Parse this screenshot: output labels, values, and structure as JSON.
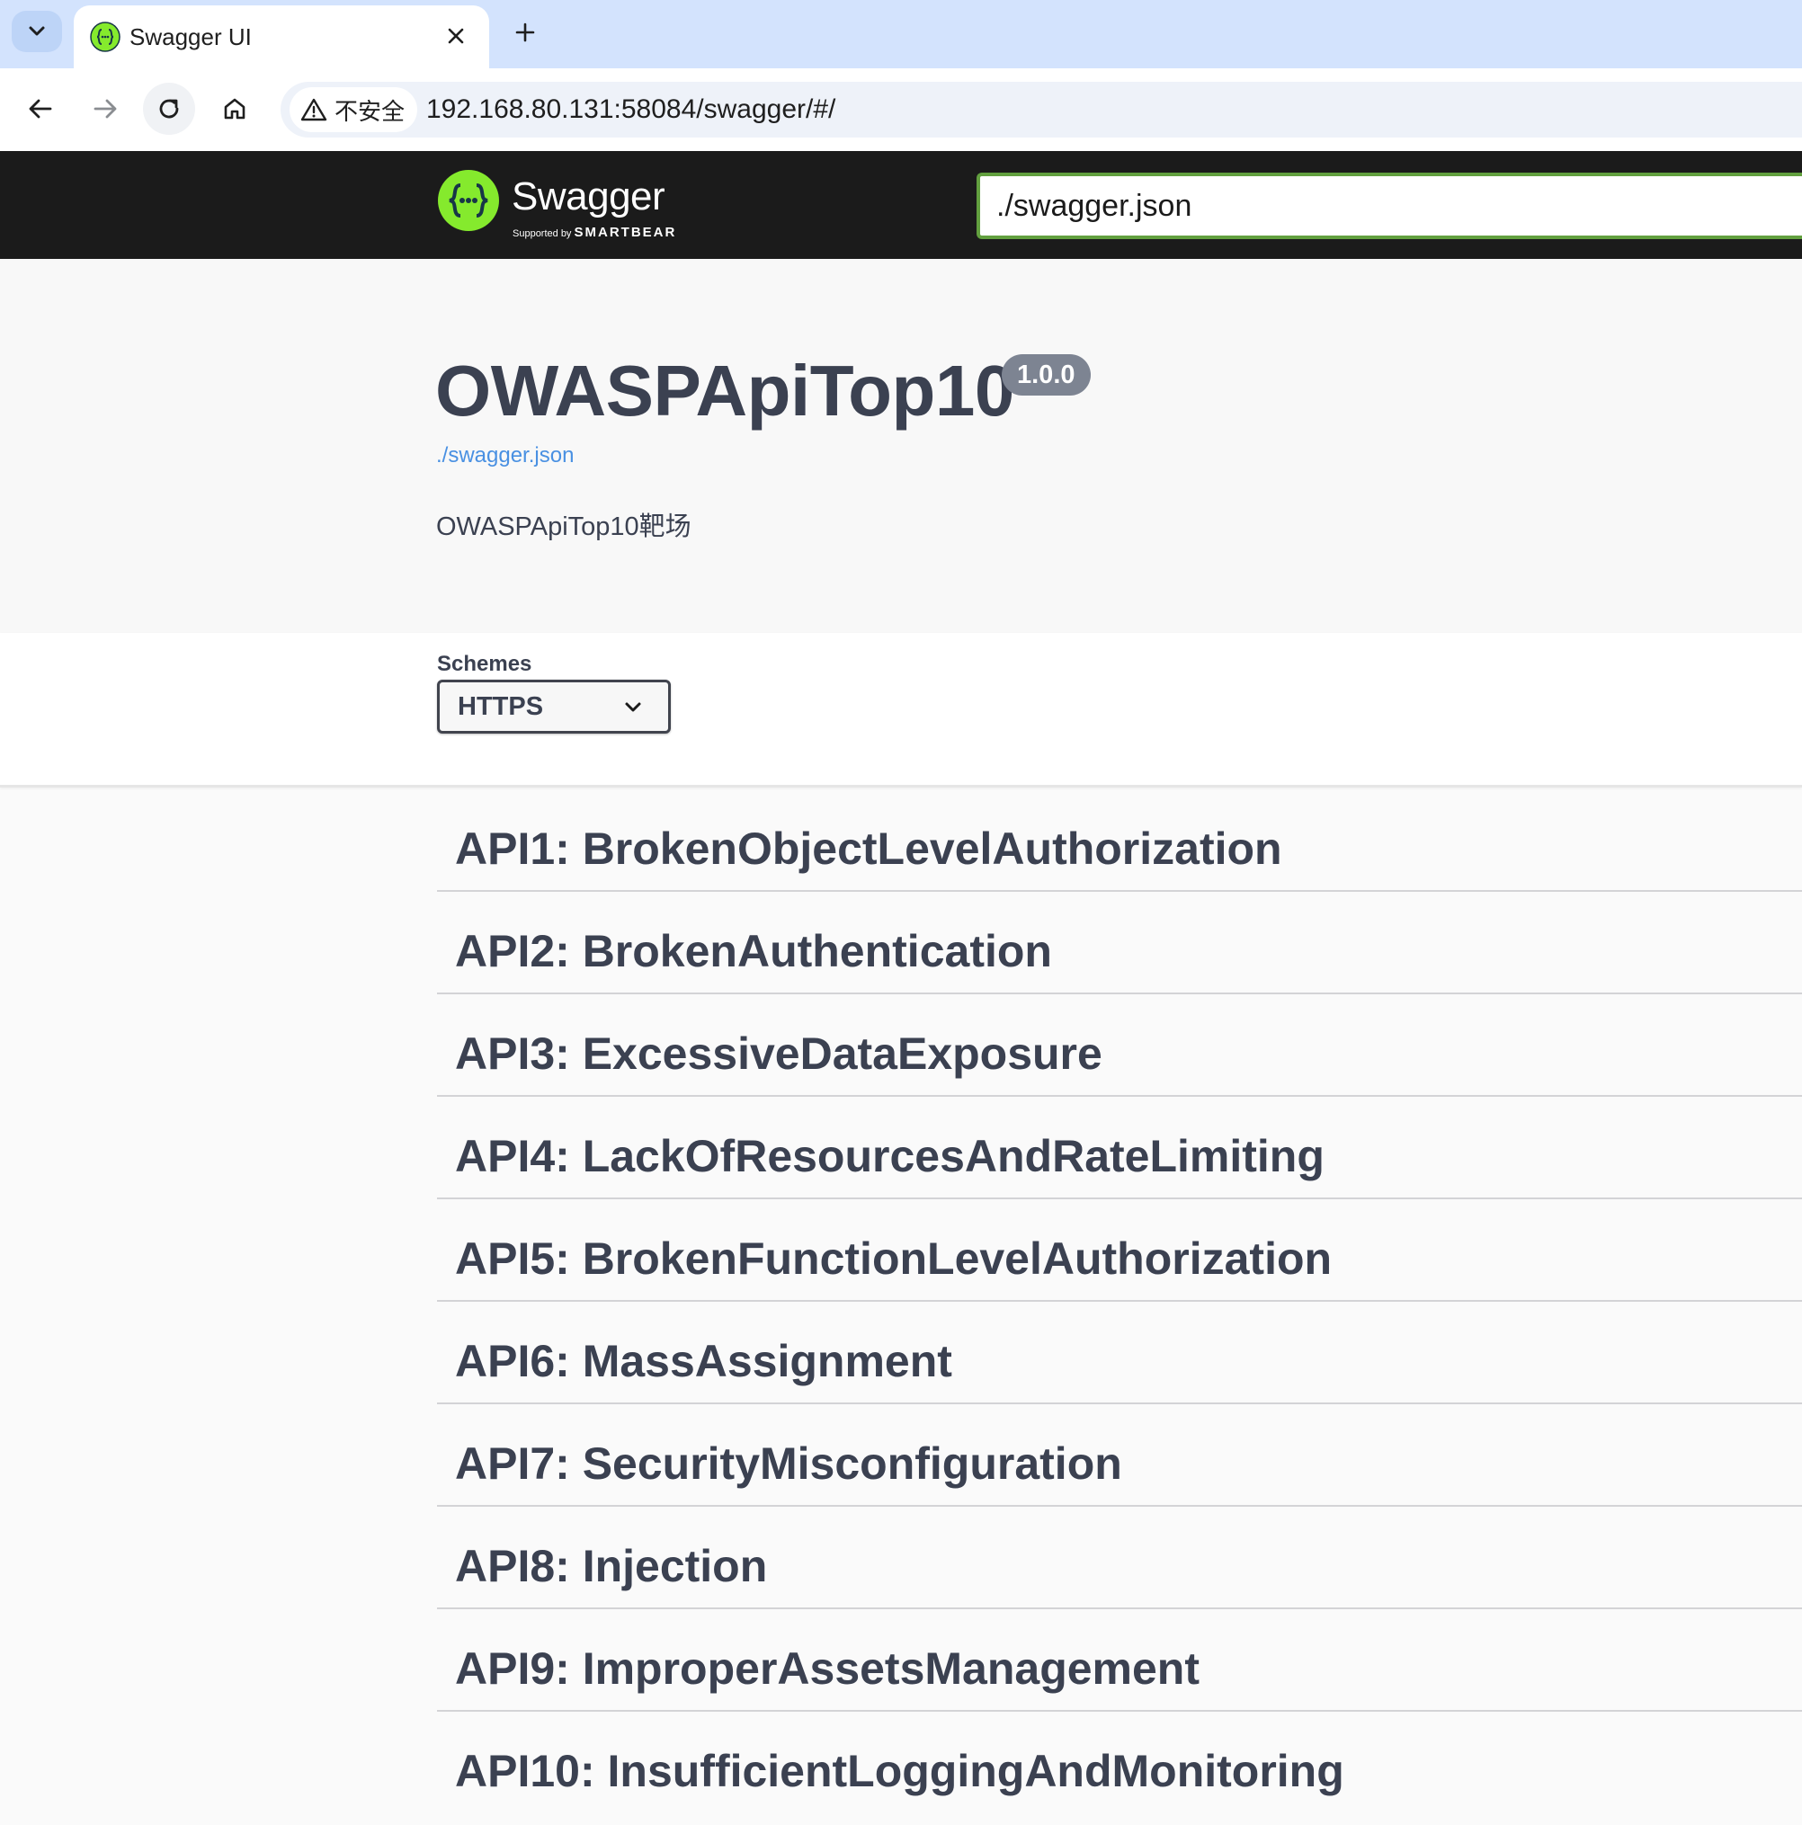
{
  "browser": {
    "tab_title": "Swagger UI",
    "security_label": "不安全",
    "url": "192.168.80.131:58084/swagger/#/"
  },
  "topbar": {
    "logo_text": "Swagger",
    "logo_sub_small": "Supported by",
    "logo_sub_brand": "SMARTBEAR",
    "spec_url_value": "./swagger.json"
  },
  "info": {
    "title": "OWASPApiTop10",
    "version": "1.0.0",
    "spec_link": "./swagger.json",
    "description": "OWASPApiTop10靶场"
  },
  "schemes": {
    "label": "Schemes",
    "selected": "HTTPS"
  },
  "tags": [
    "API1: BrokenObjectLevelAuthorization",
    "API2: BrokenAuthentication",
    "API3: ExcessiveDataExposure",
    "API4: LackOfResourcesAndRateLimiting",
    "API5: BrokenFunctionLevelAuthorization",
    "API6: MassAssignment",
    "API7: SecurityMisconfiguration",
    "API8: Injection",
    "API9: ImproperAssetsManagement",
    "API10: InsufficientLoggingAndMonitoring"
  ],
  "colors": {
    "topbar_bg": "#1b1b1b",
    "swagger_green": "#85ea2d",
    "input_border": "#62a03f",
    "text_dark": "#3b4151",
    "link_blue": "#4990e2",
    "badge_gray": "#7d8492"
  }
}
